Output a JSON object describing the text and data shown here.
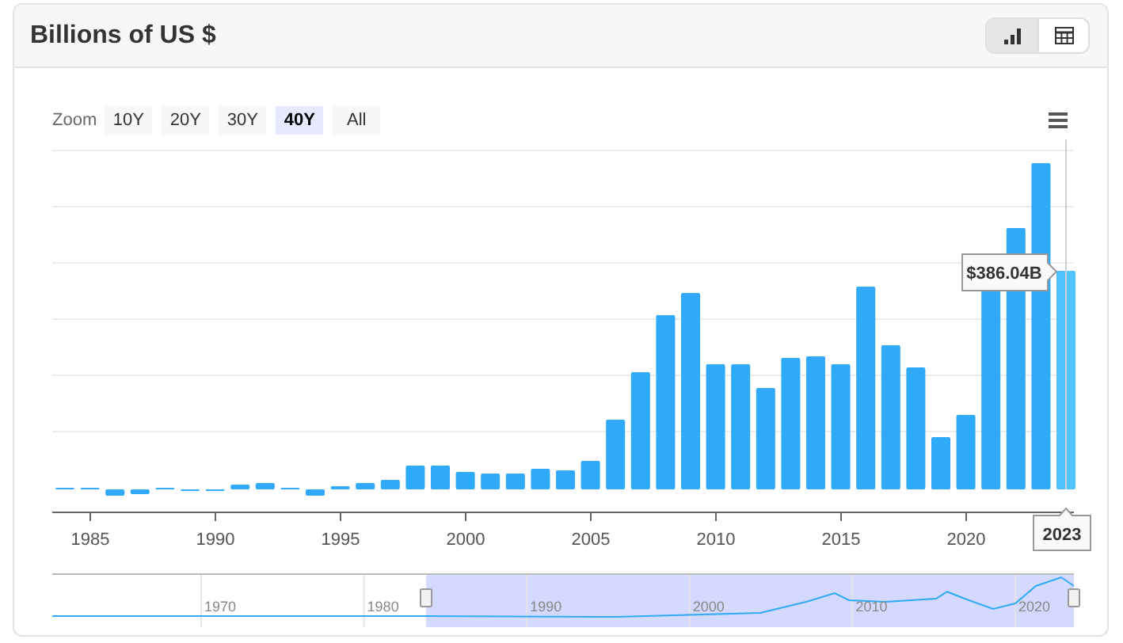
{
  "title": "Billions of US $",
  "view_toggles": [
    {
      "kind": "chart",
      "selected": true
    },
    {
      "kind": "table",
      "selected": false
    }
  ],
  "zoom": {
    "label": "Zoom",
    "buttons": [
      {
        "label": "10Y",
        "selected": false
      },
      {
        "label": "20Y",
        "selected": false
      },
      {
        "label": "30Y",
        "selected": false
      },
      {
        "label": "40Y",
        "selected": true
      },
      {
        "label": "All",
        "selected": false
      }
    ]
  },
  "chart": {
    "x_labels": [
      "1985",
      "1990",
      "1995",
      "2000",
      "2005",
      "2010",
      "2015",
      "2020"
    ],
    "tooltip_value": "$386.04B",
    "tooltip_category": "2023",
    "navigator_labels": [
      "1970",
      "1980",
      "1990",
      "2000",
      "2010",
      "2020"
    ]
  }
}
